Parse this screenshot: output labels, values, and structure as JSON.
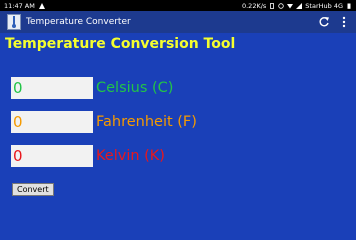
{
  "status_bar": {
    "time": "11:47 AM",
    "speed": "0.22K/s",
    "carrier": "StarHub 4G"
  },
  "app": {
    "title": "Temperature Converter",
    "icons": [
      "refresh-icon",
      "overflow-menu-icon"
    ]
  },
  "heading": "Temperature Conversion Tool",
  "fields": [
    {
      "value": "0",
      "label": "Celsius (C)",
      "color": "#22c447"
    },
    {
      "value": "0",
      "label": "Fahrenheit (F)",
      "color": "#f59a00"
    },
    {
      "value": "0",
      "label": "Kelvin (K)",
      "color": "#e8171c"
    }
  ],
  "convert_label": "Convert",
  "colors": {
    "background": "#1a40b8",
    "app_bar": "#1d3a8f",
    "heading": "#f5ff2e"
  }
}
